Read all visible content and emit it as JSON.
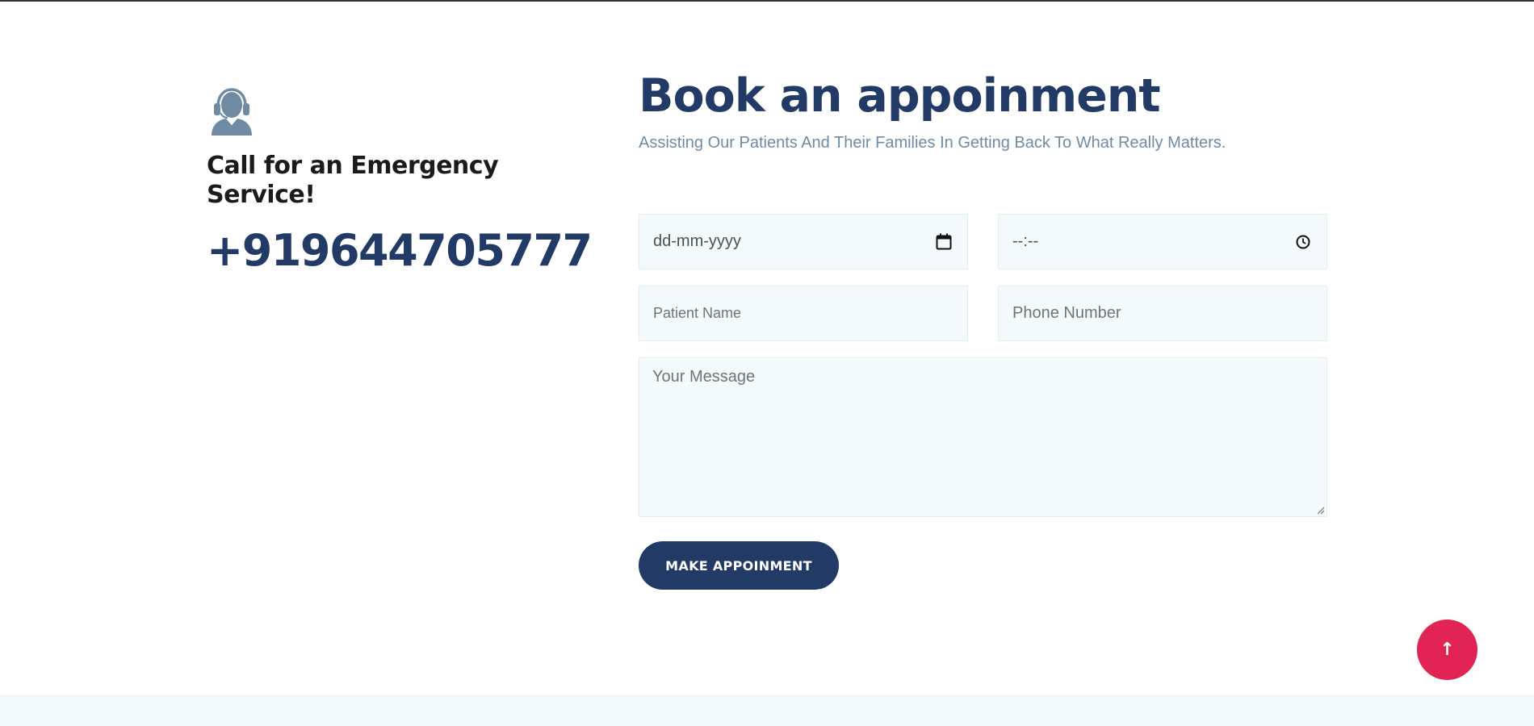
{
  "emergency": {
    "icon": "support-agent-icon",
    "title": "Call for an Emergency Service!",
    "phone": "+919644705777"
  },
  "appointment": {
    "title": "Book an appoinment",
    "subtitle": "Assisting Our Patients And Their Families In Getting Back To What Really Matters.",
    "date_field": {
      "placeholder": "dd-mm-yyyy",
      "icon": "calendar-icon"
    },
    "time_field": {
      "placeholder": "--:--",
      "icon": "clock-icon"
    },
    "patient_name": {
      "placeholder": "Patient Name"
    },
    "phone_number": {
      "placeholder": "Phone Number"
    },
    "message": {
      "placeholder": "Your Message"
    },
    "submit_label": "MAKE APPOINMENT"
  },
  "back_to_top": {
    "icon": "arrow-up-icon",
    "label": "↑"
  },
  "colors": {
    "primary": "#223a66",
    "accent": "#e12454",
    "muted_text": "#6f8ba4",
    "field_bg": "#f4f9fc"
  }
}
